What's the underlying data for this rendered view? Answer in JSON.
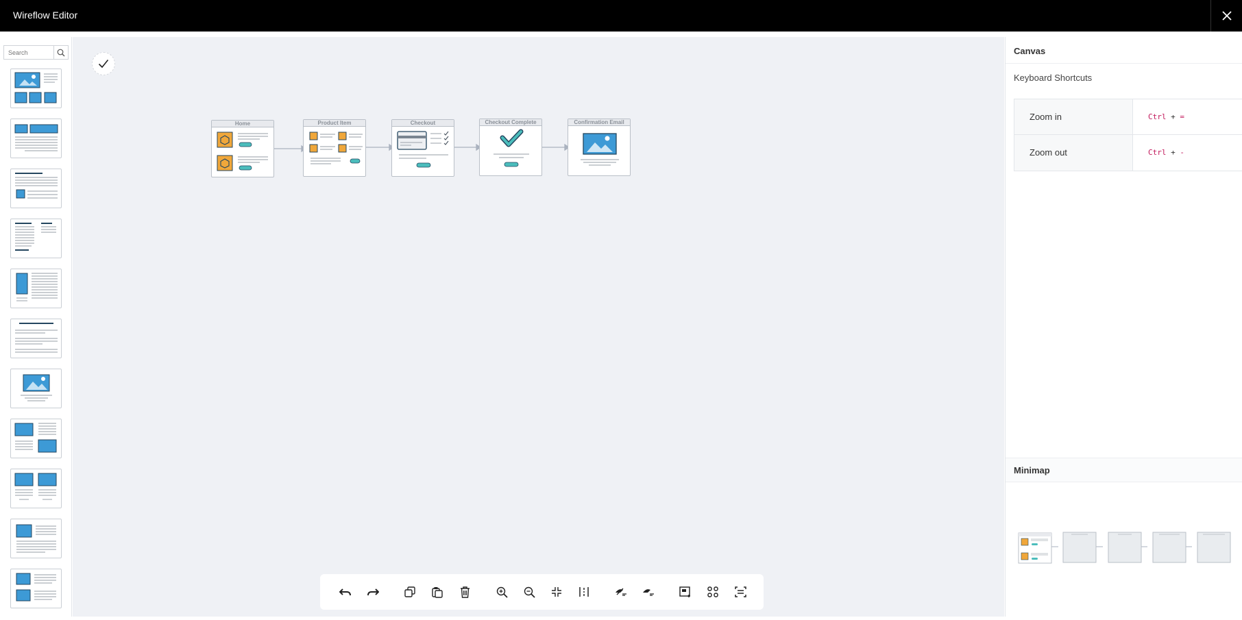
{
  "app": {
    "title": "Wireflow Editor"
  },
  "palette": {
    "search_placeholder": "Search",
    "template_count": 11
  },
  "canvas": {
    "nodes": [
      {
        "label": "Home"
      },
      {
        "label": "Product Item"
      },
      {
        "label": "Checkout"
      },
      {
        "label": "Checkout Complete"
      },
      {
        "label": "Confirmation Email"
      }
    ]
  },
  "toolbar": {
    "buttons": [
      "undo-icon",
      "redo-icon",
      "duplicate-icon",
      "paste-icon",
      "delete-icon",
      "zoom-in-icon",
      "zoom-out-icon",
      "fit-icon",
      "distribute-icon",
      "hide-ui-icon",
      "show-ui-icon",
      "add-screen-icon",
      "group-icon",
      "fit-screen-icon"
    ]
  },
  "panel": {
    "canvas_title": "Canvas",
    "shortcuts_title": "Keyboard Shortcuts",
    "shortcuts": [
      {
        "name": "Zoom in",
        "mod": "Ctrl",
        "plus": "+",
        "key": "="
      },
      {
        "name": "Zoom out",
        "mod": "Ctrl",
        "plus": "+",
        "key": "-"
      }
    ],
    "minimap_title": "Minimap"
  },
  "colors": {
    "accent_blue": "#3d9ad6",
    "accent_orange": "#f0a73a",
    "accent_teal": "#4bbdbc",
    "titlebar": "#000000",
    "canvas_bg": "#eff1f5"
  }
}
